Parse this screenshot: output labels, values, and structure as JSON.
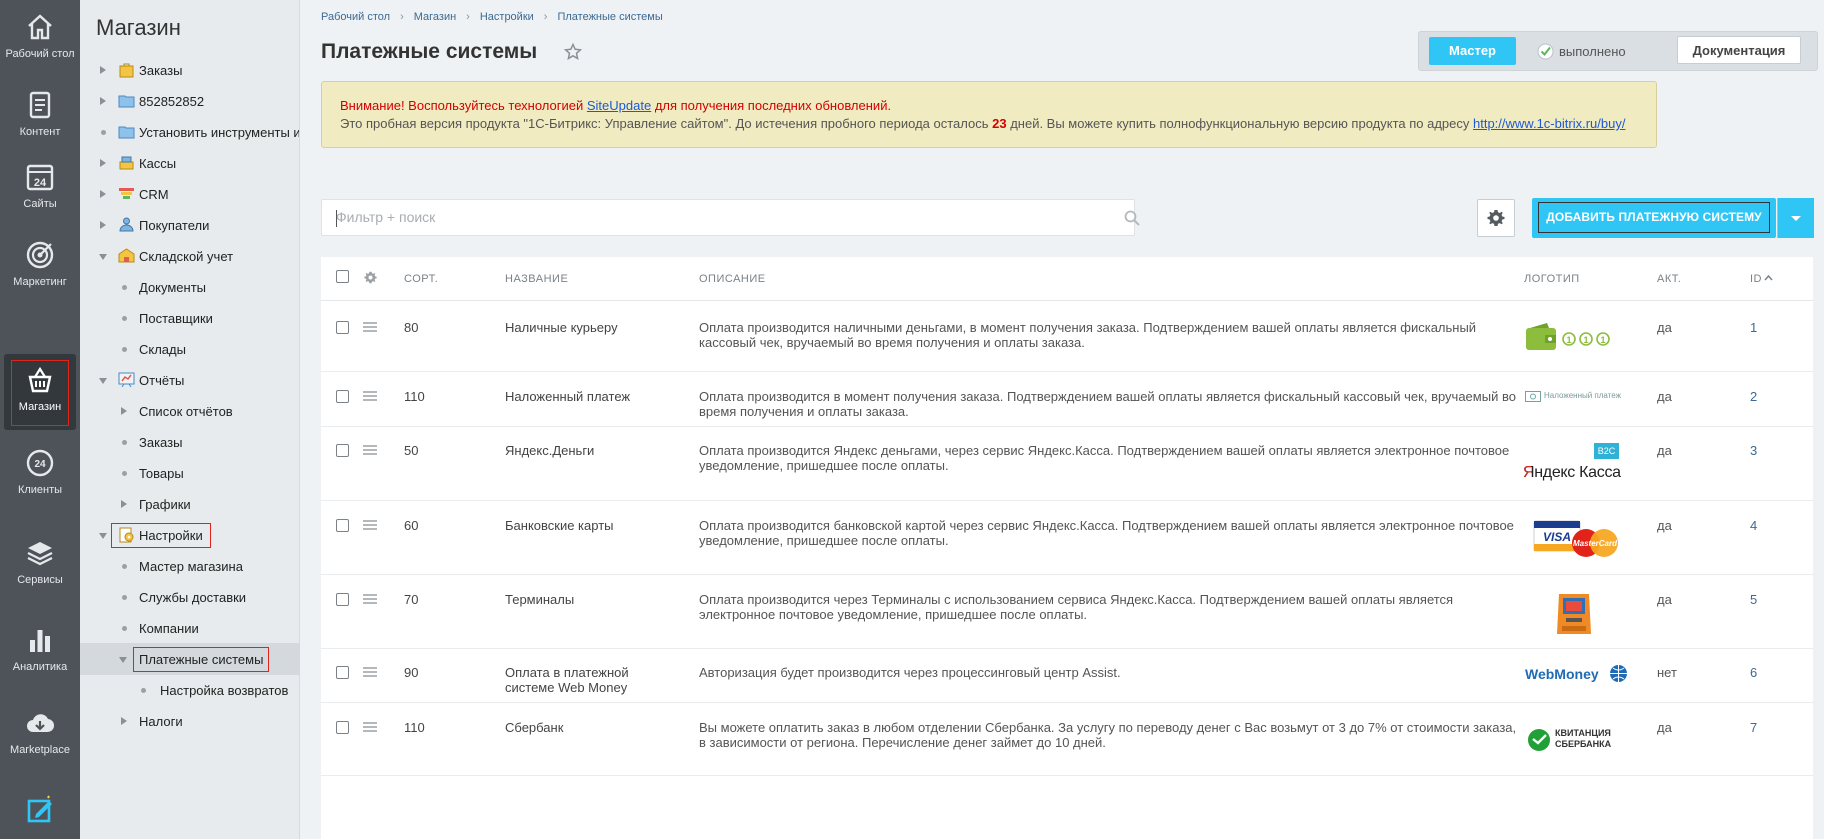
{
  "rail": {
    "items": [
      {
        "label": "Рабочий стол",
        "icon": "home-icon"
      },
      {
        "label": "Контент",
        "icon": "document-icon"
      },
      {
        "label": "Сайты",
        "icon": "calendar-24-icon"
      },
      {
        "label": "Маркетинг",
        "icon": "target-icon"
      },
      {
        "label": "Магазин",
        "icon": "basket-icon"
      },
      {
        "label": "Клиенты",
        "icon": "clients-24-icon"
      },
      {
        "label": "Сервисы",
        "icon": "layers-icon"
      },
      {
        "label": "Аналитика",
        "icon": "bar-chart-icon"
      },
      {
        "label": "Marketplace",
        "icon": "cloud-download-icon"
      }
    ]
  },
  "tree": {
    "title": "Магазин",
    "items": [
      {
        "label": "Заказы"
      },
      {
        "label": "852852852"
      },
      {
        "label": "Установить инструменты и"
      },
      {
        "label": "Кассы"
      },
      {
        "label": "CRM"
      },
      {
        "label": "Покупатели"
      },
      {
        "label": "Складской учет"
      },
      {
        "label": "Документы"
      },
      {
        "label": "Поставщики"
      },
      {
        "label": "Склады"
      },
      {
        "label": "Отчёты"
      },
      {
        "label": "Список отчётов"
      },
      {
        "label": "Заказы"
      },
      {
        "label": "Товары"
      },
      {
        "label": "Графики"
      },
      {
        "label": "Настройки"
      },
      {
        "label": "Мастер магазина"
      },
      {
        "label": "Службы доставки"
      },
      {
        "label": "Компании"
      },
      {
        "label": "Платежные системы"
      },
      {
        "label": "Настройка возвратов"
      },
      {
        "label": "Налоги"
      }
    ]
  },
  "breadcrumb": [
    "Рабочий стол",
    "Магазин",
    "Настройки",
    "Платежные системы"
  ],
  "page_title": "Платежные системы",
  "master": {
    "button": "Мастер",
    "status": "выполнено",
    "docs": "Документация"
  },
  "notice": {
    "warn_before": "Внимание! Воспользуйтесь технологией ",
    "warn_link": "SiteUpdate",
    "warn_after": " для получения последних обновлений.",
    "trial_before": "Это пробная версия продукта \"1С-Битрикс: Управление сайтом\". До истечения пробного периода осталось ",
    "trial_days": "23",
    "trial_after": " дней. Вы можете купить полнофункциональную версию продукта по адресу ",
    "trial_link": "http://www.1c-bitrix.ru/buy/"
  },
  "filter": {
    "placeholder": "Фильтр + поиск"
  },
  "add_button": "ДОБАВИТЬ ПЛАТЕЖНУЮ СИСТЕМУ",
  "grid": {
    "columns": {
      "sort": "СОРТ.",
      "name": "НАЗВАНИЕ",
      "description": "ОПИСАНИЕ",
      "logo": "ЛОГОТИП",
      "active": "АКТ.",
      "id": "ID"
    },
    "rows": [
      {
        "sort": "80",
        "name": "Наличные курьеру",
        "description": "Оплата производится наличными деньгами, в момент получения заказа. Подтверждением вашей оплаты является фискальный кассовый чек, вручаемый во время получения и оплаты заказа.",
        "logo": "cash-wallet-logo",
        "active": "да",
        "id": "1"
      },
      {
        "sort": "110",
        "name": "Наложенный платеж",
        "description": "Оплата производится в момент получения заказа. Подтверждением вашей оплаты является фискальный кассовый чек, вручаемый во время получения и оплаты заказа.",
        "logo": "cod-logo",
        "logo_text": "Наложенный платеж",
        "active": "да",
        "id": "2"
      },
      {
        "sort": "50",
        "name": "Яндекс.Деньги",
        "description": "Оплата производится Яндекс деньгами, через сервис Яндекс.Касса. Подтверждением вашей оплаты является электронное почтовое уведомление, пришедшее после оплаты.",
        "logo": "yandex-kassa-logo",
        "logo_text": "Яндекс Касса",
        "logo_badge": "B2C",
        "active": "да",
        "id": "3"
      },
      {
        "sort": "60",
        "name": "Банковские карты",
        "description": "Оплата производится банковской картой через сервис Яндекс.Касса. Подтверждением вашей оплаты является электронное почтовое уведомление, пришедшее после оплаты.",
        "logo": "visa-mastercard-logo",
        "active": "да",
        "id": "4"
      },
      {
        "sort": "70",
        "name": "Терминалы",
        "description": "Оплата производится через Терминалы с использованием сервиса Яндекс.Касса. Подтверждением вашей оплаты является электронное почтовое уведомление, пришедшее после оплаты.",
        "logo": "terminal-logo",
        "active": "да",
        "id": "5"
      },
      {
        "sort": "90",
        "name": "Оплата в платежной системе Web Money",
        "description": "Авторизация будет производится через процессинговый центр Assist.",
        "logo": "webmoney-logo",
        "logo_text": "WebMoney",
        "active": "нет",
        "id": "6"
      },
      {
        "sort": "110",
        "name": "Сбербанк",
        "description": "Вы можете оплатить заказ в любом отделении Сбербанка. За услугу по переводу денег с Вас возьмут от 3 до 7% от стоимости заказа, в зависимости от региона. Перечисление денег займет до 10 дней.",
        "logo": "sberbank-logo",
        "logo_text": "КВИТАНЦИЯ СБЕРБАНКА",
        "active": "да",
        "id": "7"
      }
    ]
  },
  "colors": {
    "accent": "#2fc6f6",
    "link": "#3d6994",
    "warning": "#d40000",
    "highlight": "#e0241b"
  }
}
